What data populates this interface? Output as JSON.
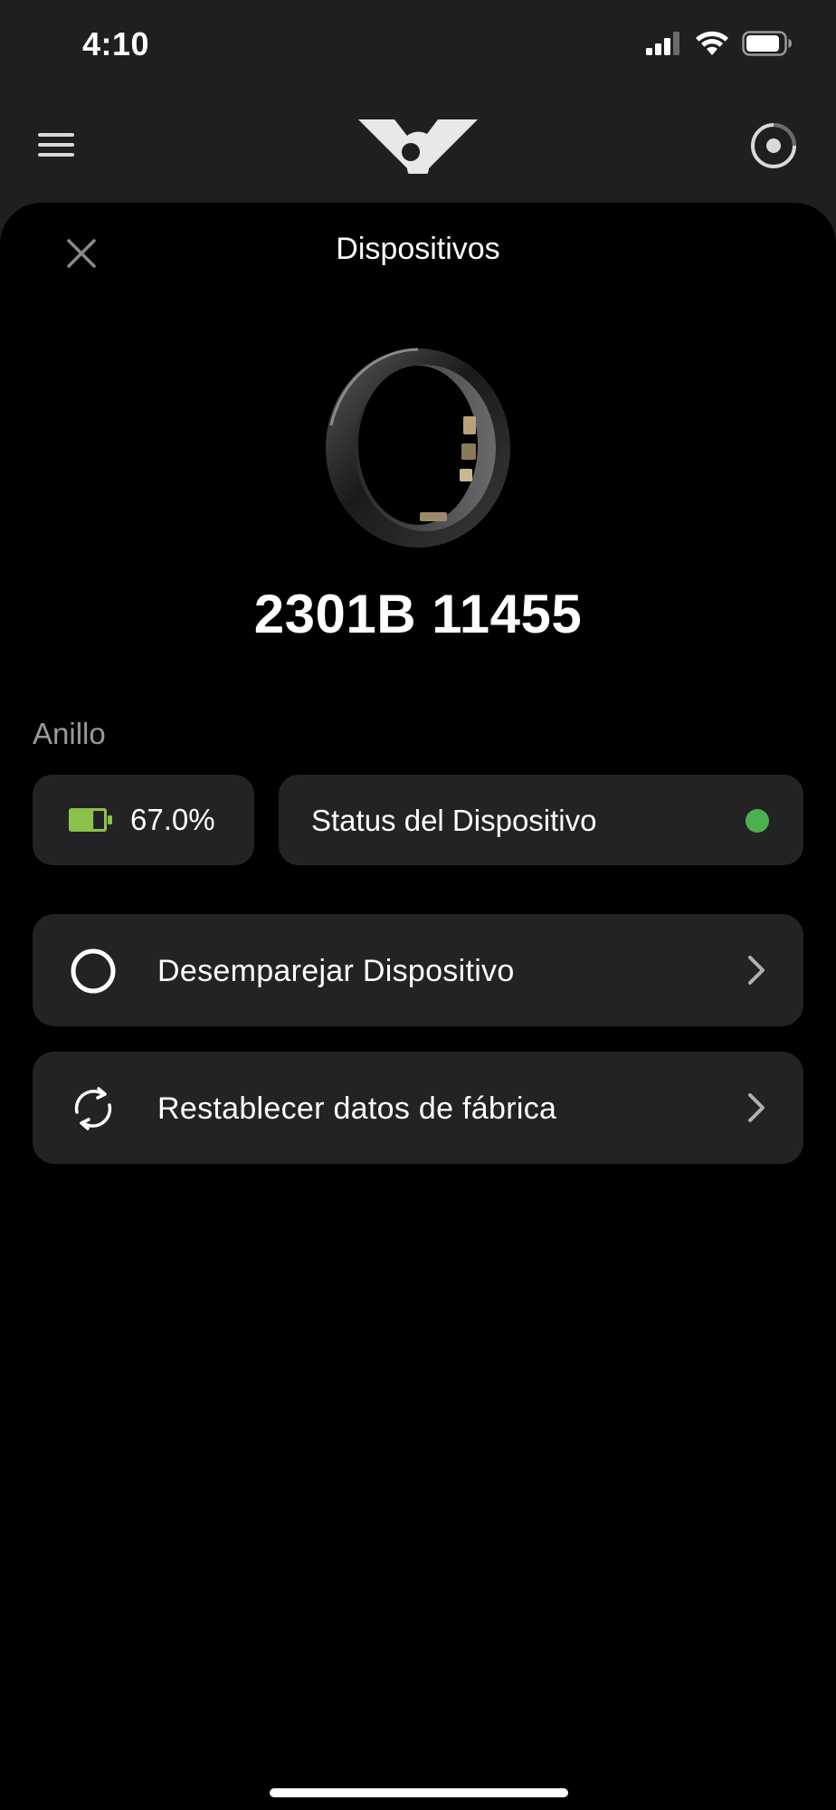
{
  "status_bar": {
    "time": "4:10",
    "icons": [
      "cellular-signal-icon",
      "wifi-icon",
      "battery-icon"
    ]
  },
  "header": {
    "icons": [
      "menu-icon",
      "brand-logo",
      "ring-icon"
    ]
  },
  "sheet": {
    "title": "Dispositivos",
    "device_id": "2301B 11455",
    "section_label": "Anillo",
    "battery": {
      "value": "67.0%",
      "level": 0.67,
      "color": "#8bc34a"
    },
    "status": {
      "label": "Status del Dispositivo",
      "indicator_color": "#4cb051"
    },
    "actions": [
      {
        "label": "Desemparejar Dispositivo",
        "icon": "circle-icon"
      },
      {
        "label": "Restablecer datos de fábrica",
        "icon": "refresh-icon"
      }
    ]
  },
  "colors": {
    "background": "#000000",
    "header_background": "#1f1f21",
    "card": "#232325",
    "muted_text": "#9a9a9c"
  }
}
